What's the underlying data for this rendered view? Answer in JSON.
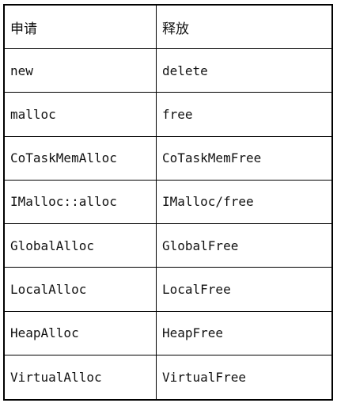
{
  "table": {
    "headers": [
      "申请",
      "释放"
    ],
    "rows": [
      [
        "new",
        "delete"
      ],
      [
        "malloc",
        "free"
      ],
      [
        "CoTaskMemAlloc",
        "CoTaskMemFree"
      ],
      [
        "IMalloc::alloc",
        "IMalloc/free"
      ],
      [
        "GlobalAlloc",
        "GlobalFree"
      ],
      [
        "LocalAlloc",
        "LocalFree"
      ],
      [
        "HeapAlloc",
        "HeapFree"
      ],
      [
        "VirtualAlloc",
        "VirtualFree"
      ]
    ]
  }
}
